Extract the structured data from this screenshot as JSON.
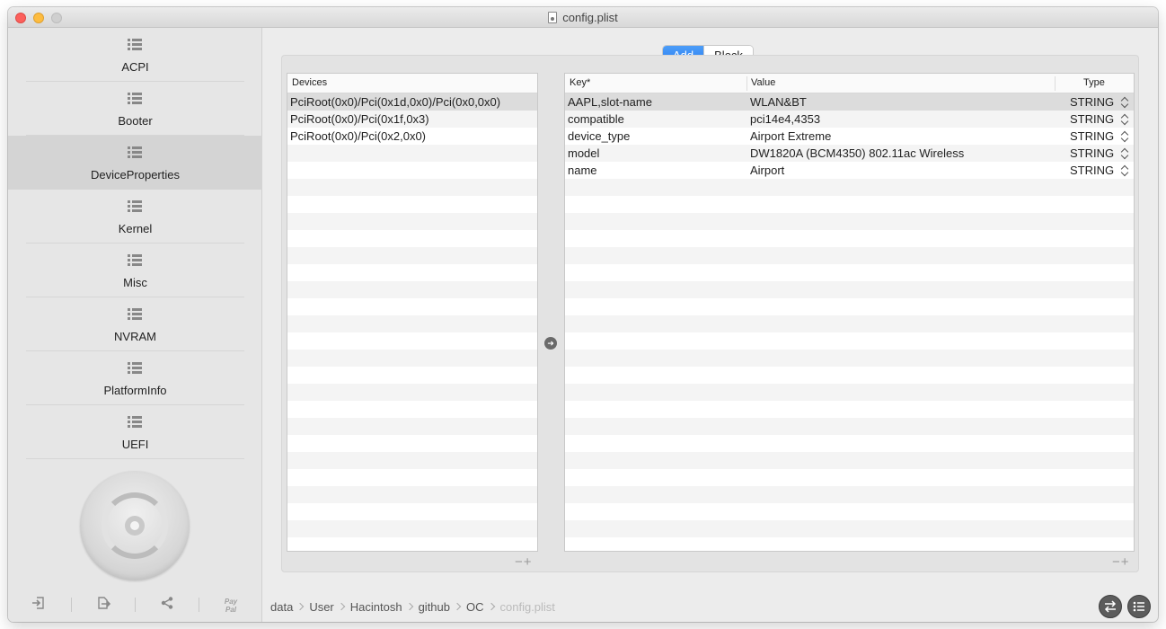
{
  "window": {
    "title": "config.plist"
  },
  "sidebar": {
    "items": [
      {
        "label": "ACPI",
        "selected": false
      },
      {
        "label": "Booter",
        "selected": false
      },
      {
        "label": "DeviceProperties",
        "selected": true
      },
      {
        "label": "Kernel",
        "selected": false
      },
      {
        "label": "Misc",
        "selected": false
      },
      {
        "label": "NVRAM",
        "selected": false
      },
      {
        "label": "PlatformInfo",
        "selected": false
      },
      {
        "label": "UEFI",
        "selected": false
      }
    ],
    "footer": {
      "import_icon": "import-icon",
      "export_icon": "export-icon",
      "share_icon": "share-icon",
      "paypal_text": "Pay Pal"
    }
  },
  "segmented": {
    "tabs": [
      "Add",
      "Block"
    ],
    "active": "Add"
  },
  "devices_table": {
    "header": "Devices",
    "rows": [
      "PciRoot(0x0)/Pci(0x1d,0x0)/Pci(0x0,0x0)",
      "PciRoot(0x0)/Pci(0x1f,0x3)",
      "PciRoot(0x0)/Pci(0x2,0x0)"
    ],
    "selected_index": 0,
    "minus": "−",
    "plus": "+"
  },
  "properties_table": {
    "headers": {
      "key": "Key*",
      "value": "Value",
      "type": "Type"
    },
    "rows": [
      {
        "key": "AAPL,slot-name",
        "value": "WLAN&BT",
        "type": "STRING"
      },
      {
        "key": "compatible",
        "value": "pci14e4,4353",
        "type": "STRING"
      },
      {
        "key": "device_type",
        "value": "Airport Extreme",
        "type": "STRING"
      },
      {
        "key": "model",
        "value": "DW1820A (BCM4350) 802.11ac Wireless",
        "type": "STRING"
      },
      {
        "key": "name",
        "value": "Airport",
        "type": "STRING"
      }
    ],
    "selected_index": 0,
    "minus": "−",
    "plus": "+"
  },
  "pathbar": {
    "crumbs": [
      "data",
      "User",
      "Hacintosh",
      "github",
      "OC",
      "config.plist"
    ]
  },
  "colors": {
    "accent": "#2a7df0",
    "selection": "#dcdcdc",
    "sidebar_selected": "#d4d4d4"
  }
}
